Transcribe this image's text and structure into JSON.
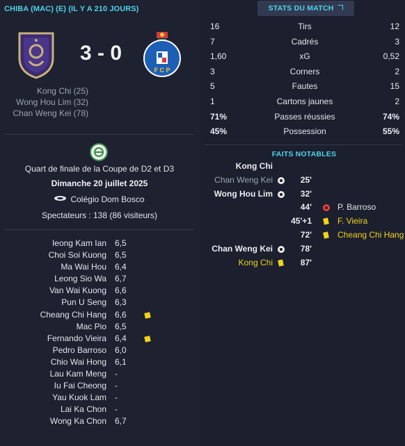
{
  "match": {
    "title": "CHIBA (MAC) (E) (IL Y A 210 JOURS)",
    "score": "3 - 0",
    "home_scorers": [
      "Kong Chi (25)",
      "Wong Hou Lim (32)",
      "Chan Weng Kei (78)"
    ]
  },
  "competition": {
    "name": "Quart de finale de la Coupe de D2 et D3",
    "date": "Dimanche 20 juillet 2025",
    "stadium": "Colégio Dom Bosco",
    "spectators": "Spectateurs : 138 (86 visiteurs)"
  },
  "players": [
    {
      "name": "Ieong Kam Ian",
      "rating": "6,5",
      "card": ""
    },
    {
      "name": "Choi Soi Kuong",
      "rating": "6,5",
      "card": ""
    },
    {
      "name": "Ma Wai Hou",
      "rating": "6,4",
      "card": ""
    },
    {
      "name": "Leong Sio Wa",
      "rating": "6,7",
      "card": ""
    },
    {
      "name": "Van Wai Kuong",
      "rating": "6,6",
      "card": ""
    },
    {
      "name": "Pun U Seng",
      "rating": "6,3",
      "card": ""
    },
    {
      "name": "Cheang Chi Hang",
      "rating": "6,6",
      "card": "yellow"
    },
    {
      "name": "Mac Pio",
      "rating": "6,5",
      "card": ""
    },
    {
      "name": "Fernando Vieira",
      "rating": "6,4",
      "card": "yellow"
    },
    {
      "name": "Pedro Barroso",
      "rating": "6,0",
      "card": ""
    },
    {
      "name": "Chio Wai Hong",
      "rating": "6,1",
      "card": ""
    },
    {
      "name": "Lau Kam Meng",
      "rating": "-",
      "card": ""
    },
    {
      "name": "Iu Fai Cheong",
      "rating": "-",
      "card": ""
    },
    {
      "name": "Yau Kuok Lam",
      "rating": "-",
      "card": ""
    },
    {
      "name": "Lai Ka Chon",
      "rating": "-",
      "card": ""
    },
    {
      "name": "Wong Ka Chon",
      "rating": "6,7",
      "card": ""
    }
  ],
  "stats_button": "STATS DU MATCH",
  "stats": [
    {
      "home": "16",
      "label": "Tirs",
      "away": "12",
      "home_bold": false,
      "away_bold": false
    },
    {
      "home": "7",
      "label": "Cadrés",
      "away": "3",
      "home_bold": false,
      "away_bold": false
    },
    {
      "home": "1,60",
      "label": "xG",
      "away": "0,52",
      "home_bold": false,
      "away_bold": false
    },
    {
      "home": "3",
      "label": "Corners",
      "away": "2",
      "home_bold": false,
      "away_bold": false
    },
    {
      "home": "5",
      "label": "Fautes",
      "away": "15",
      "home_bold": false,
      "away_bold": false
    },
    {
      "home": "1",
      "label": "Cartons jaunes",
      "away": "2",
      "home_bold": false,
      "away_bold": false
    },
    {
      "home": "71%",
      "label": "Passes réussies",
      "away": "74%",
      "home_bold": true,
      "away_bold": true
    },
    {
      "home": "45%",
      "label": "Possession",
      "away": "55%",
      "home_bold": true,
      "away_bold": true
    }
  ],
  "facts_title": "FAITS NOTABLES",
  "facts": [
    {
      "home": "Kong Chi",
      "home_style": "white",
      "home_icon": "",
      "minute": "",
      "away_icon": "",
      "away": "",
      "away_style": ""
    },
    {
      "home": "Chan Weng Kei",
      "home_style": "grey",
      "home_icon": "goal",
      "minute": "25'",
      "away_icon": "",
      "away": "",
      "away_style": ""
    },
    {
      "home": "Wong Hou Lim",
      "home_style": "white",
      "home_icon": "goal",
      "minute": "32'",
      "away_icon": "",
      "away": "",
      "away_style": ""
    },
    {
      "home": "",
      "home_style": "",
      "home_icon": "",
      "minute": "44'",
      "away_icon": "own-goal",
      "away": "P. Barroso",
      "away_style": "plain"
    },
    {
      "home": "",
      "home_style": "",
      "home_icon": "",
      "minute": "45'+1",
      "away_icon": "yellow-card",
      "away": "F. Vieira",
      "away_style": "yellow"
    },
    {
      "home": "",
      "home_style": "",
      "home_icon": "",
      "minute": "72'",
      "away_icon": "yellow-card",
      "away": "Cheang Chi Hang",
      "away_style": "yellow"
    },
    {
      "home": "Chan Weng Kei",
      "home_style": "white",
      "home_icon": "goal",
      "minute": "78'",
      "away_icon": "",
      "away": "",
      "away_style": ""
    },
    {
      "home": "Kong Chi",
      "home_style": "yellow",
      "home_icon": "yellow-card",
      "minute": "87'",
      "away_icon": "",
      "away": "",
      "away_style": ""
    }
  ],
  "colors": {
    "accent": "#4fd3e9",
    "background": "#1b1f2e",
    "yellow_card": "#f2d31a",
    "home_crest": "#3b2a6e",
    "away_crest": "#1d5fb4"
  }
}
